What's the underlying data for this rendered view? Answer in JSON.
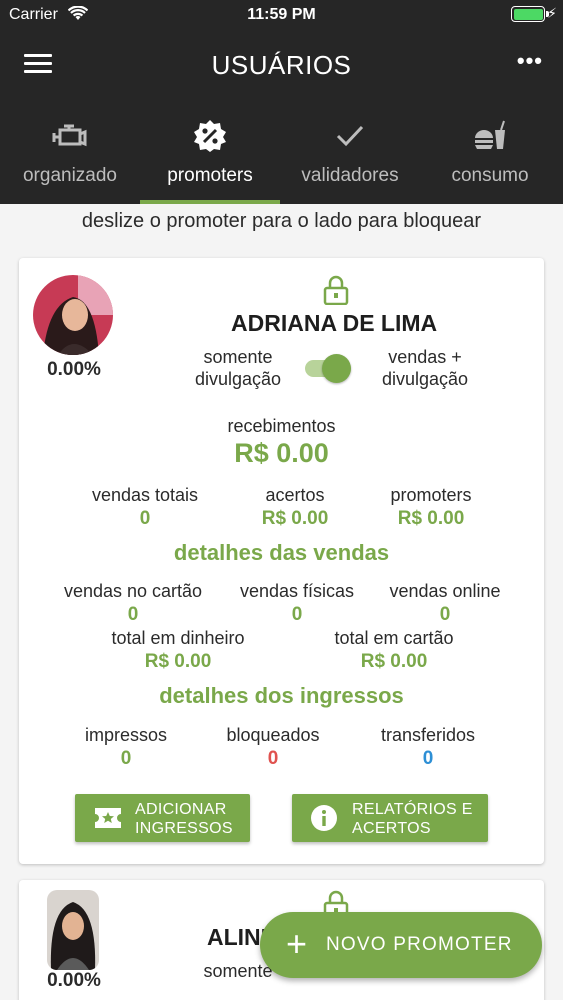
{
  "status_bar": {
    "carrier": "Carrier",
    "time": "11:59 PM"
  },
  "header": {
    "title": "USUÁRIOS"
  },
  "tabs": [
    {
      "label": "organizado",
      "icon": "engine-icon",
      "active": false
    },
    {
      "label": "promoters",
      "icon": "percent-badge-icon",
      "active": true
    },
    {
      "label": "validadores",
      "icon": "checkmark-icon",
      "active": false
    },
    {
      "label": "consumo",
      "icon": "food-drink-icon",
      "active": false
    }
  ],
  "hint": "deslize o promoter para o lado para bloquear",
  "promoters": [
    {
      "name": "ADRIANA DE LIMA",
      "percent": "0.00%",
      "mode_left": "somente divulgação",
      "mode_right": "vendas + divulgação",
      "receipts_label": "recebimentos",
      "receipts_value": "R$ 0.00",
      "summary": [
        {
          "label": "vendas totais",
          "value": "0"
        },
        {
          "label": "acertos",
          "value": "R$ 0.00"
        },
        {
          "label": "promoters",
          "value": "R$ 0.00"
        }
      ],
      "sales_title": "detalhes das vendas",
      "sales": [
        {
          "label": "vendas no cartão",
          "value": "0"
        },
        {
          "label": "vendas físicas",
          "value": "0"
        },
        {
          "label": "vendas online",
          "value": "0"
        }
      ],
      "totals": [
        {
          "label": "total em dinheiro",
          "value": "R$ 0.00"
        },
        {
          "label": "total em cartão",
          "value": "R$ 0.00"
        }
      ],
      "tickets_title": "detalhes dos ingressos",
      "tickets": [
        {
          "label": "impressos",
          "value": "0",
          "color": "#7aa84a"
        },
        {
          "label": "bloqueados",
          "value": "0",
          "color": "#e0524f"
        },
        {
          "label": "transferidos",
          "value": "0",
          "color": "#2d8fd5"
        }
      ],
      "buttons": {
        "add_tickets": "ADICIONAR\nINGRESSOS",
        "reports": "RELATÓRIOS E\nACERTOS"
      }
    },
    {
      "name": "ALINE",
      "percent": "0.00%",
      "mode_left": "somente"
    }
  ],
  "fab": {
    "label": "NOVO PROMOTER"
  },
  "colors": {
    "accent": "#7aa84a",
    "dark": "#262626",
    "danger": "#e0524f",
    "info": "#2d8fd5"
  }
}
